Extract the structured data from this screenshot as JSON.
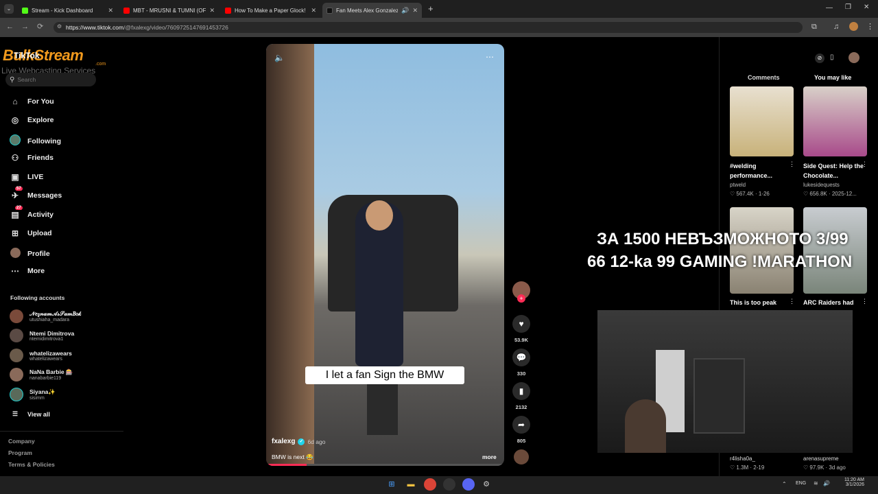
{
  "tabs": [
    {
      "title": "Stream - Kick Dashboard",
      "color": "#53fc18"
    },
    {
      "title": "MBT - MRUSNI & TUMNI (OFFI",
      "color": "#ff0000"
    },
    {
      "title": "How To Make a Paper Glock!",
      "color": "#ff0000"
    },
    {
      "title": "Fan Meets Alex Gonzalez at",
      "color": "#000000"
    }
  ],
  "url": {
    "host": "https://www.tiktok.com",
    "path": "/@fxalexg/video/7609725147691453726"
  },
  "logo": {
    "line1": "BulkStream",
    "line2": "Live Webcasting Services",
    "sub": ".com",
    "tiktok": "TikTok"
  },
  "search": {
    "placeholder": "Search"
  },
  "nav": [
    {
      "label": "For You",
      "icon": "home-icon",
      "glyph": "⌂"
    },
    {
      "label": "Explore",
      "icon": "compass-icon",
      "glyph": "◎"
    },
    {
      "label": "Following",
      "icon": "following-avatar-icon",
      "glyph": "●"
    },
    {
      "label": "Friends",
      "icon": "friends-icon",
      "glyph": "⚇"
    },
    {
      "label": "LIVE",
      "icon": "live-icon",
      "glyph": "▣"
    },
    {
      "label": "Messages",
      "icon": "messages-icon",
      "glyph": "✈",
      "badge": "57"
    },
    {
      "label": "Activity",
      "icon": "activity-icon",
      "glyph": "▤",
      "badge": "27"
    },
    {
      "label": "Upload",
      "icon": "upload-icon",
      "glyph": "⊞"
    },
    {
      "label": "Profile",
      "icon": "profile-icon",
      "glyph": "●"
    },
    {
      "label": "More",
      "icon": "more-icon",
      "glyph": "⋯"
    }
  ],
  "following_header": "Following accounts",
  "accounts": [
    {
      "name": "𝒩𝑒𝓏𝓃𝒶𝓂𝒜𝓈𝒮𝒶𝓂𝐵𝑜𝓀",
      "handle": "utushiaha_madara"
    },
    {
      "name": "Ntemi Dimitrova",
      "handle": "ntemidimitrova1"
    },
    {
      "name": "whatelizawears",
      "handle": "whatelizawears"
    },
    {
      "name": "NaNa Barbie 🎰",
      "handle": "nanabarbie119"
    },
    {
      "name": "Siyana✨",
      "handle": "sisimm"
    }
  ],
  "view_all": "View all",
  "footer": [
    "Company",
    "Program",
    "Terms & Policies"
  ],
  "video": {
    "caption": "I let a fan Sign the BMW",
    "author": "fxalexg",
    "age": "6d ago",
    "desc": "BMW is next 😂",
    "more": "more",
    "progress": 0.17
  },
  "actions": {
    "likes": "53.9K",
    "comments": "330",
    "saves": "2132",
    "shares": "805"
  },
  "right": {
    "tab_comments": "Comments",
    "tab_you_may_like": "You may like",
    "cards": [
      {
        "title": "#welding performance...",
        "author": "ptweld",
        "stats": "♡ 567.4K · 1-26",
        "color": "#c8b27a"
      },
      {
        "title": "Side Quest: Help the Chocolate...",
        "author": "lukesidequests",
        "stats": "♡ 656.8K · 2025-12...",
        "color": "#7a5a9a"
      },
      {
        "title": "This is too peak",
        "author": "",
        "stats": "",
        "color": "#bdb6a6"
      },
      {
        "title": "ARC Raiders had",
        "author": "",
        "stats": "",
        "color": "#9aa39a"
      }
    ],
    "bottom": [
      {
        "author": "r4lisha0a_",
        "stats": "♡ 1.3M · 2-19"
      },
      {
        "author": "arenasupreme",
        "stats": "♡ 97.9K · 3d ago"
      }
    ]
  },
  "overlay": {
    "line1": "ЗА 1500 НЕВЪЗМОЖНОТО 3/99",
    "line2": "66 12-ka 99 GAMING !MARATHON"
  },
  "taskbar": {
    "lang": "ENG",
    "time": "11:20 AM",
    "date": "3/1/2026"
  }
}
